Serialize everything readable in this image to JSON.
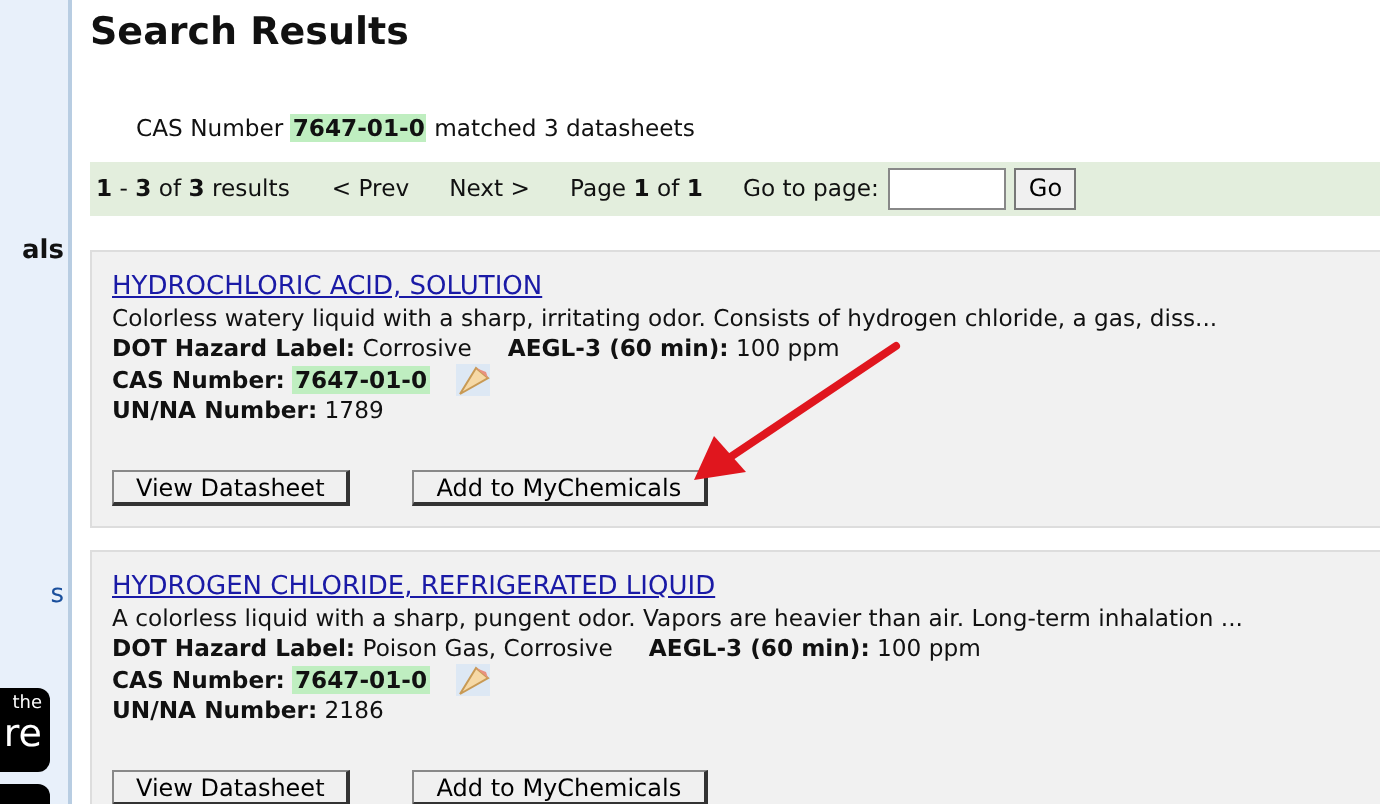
{
  "sidebar": {
    "items": [
      {
        "text": "als"
      },
      {
        "text": "s"
      }
    ],
    "badge": {
      "lines": [
        "the",
        "re"
      ]
    }
  },
  "title": "Search Results",
  "summary": {
    "prefix": "CAS Number",
    "cas": "7647-01-0",
    "suffix": "matched 3 datasheets"
  },
  "pager": {
    "range": "**1** - **3** of **3** results",
    "prev": "< Prev",
    "next": "Next >",
    "page": "Page **1** of **1**",
    "goto_label": "Go to page:",
    "go_button": "Go"
  },
  "results": [
    {
      "name": "HYDROCHLORIC ACID, SOLUTION",
      "description": "Colorless watery liquid with a sharp, irritating odor. Consists of hydrogen chloride, a gas, diss...",
      "dot_label": "DOT Hazard Label:",
      "dot_value": "Corrosive",
      "aegl_label": "AEGL-3 (60 min):",
      "aegl_value": "100 ppm",
      "cas_label": "CAS Number:",
      "cas": "7647-01-0",
      "un_label": "UN/NA Number:",
      "un_value": "1789",
      "buttons": [
        "View Datasheet",
        "Add to MyChemicals"
      ],
      "annotated": true
    },
    {
      "name": "HYDROGEN CHLORIDE, REFRIGERATED LIQUID",
      "description": "A colorless liquid with a sharp, pungent odor. Vapors are heavier than air. Long-term inhalation ...",
      "dot_label": "DOT Hazard Label:",
      "dot_value": "Poison Gas, Corrosive",
      "aegl_label": "AEGL-3 (60 min):",
      "aegl_value": "100 ppm",
      "cas_label": "CAS Number:",
      "cas": "7647-01-0",
      "un_label": "UN/NA Number:",
      "un_value": "2186",
      "buttons": [
        "View Datasheet",
        "Add to MyChemicals"
      ],
      "annotated": false
    }
  ]
}
